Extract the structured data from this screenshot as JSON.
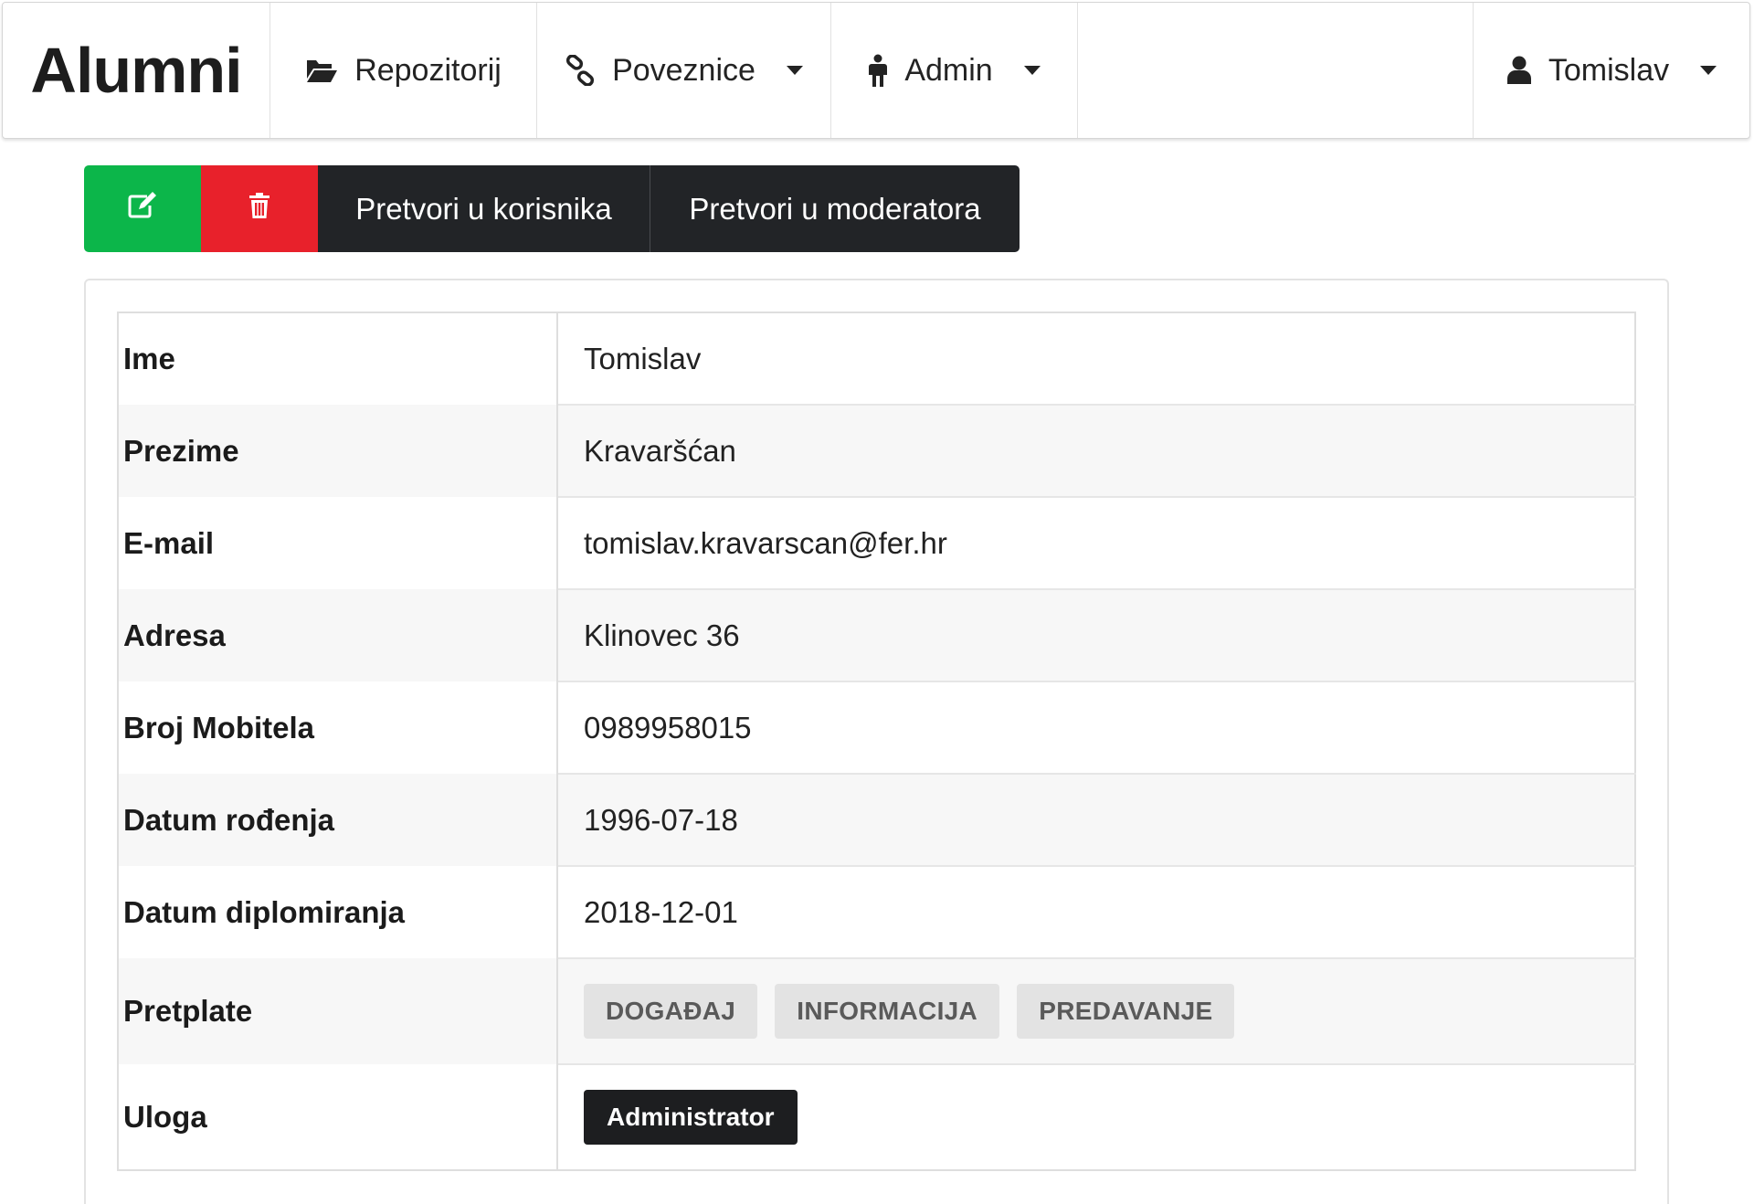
{
  "navbar": {
    "brand": "Alumni",
    "items": [
      {
        "label": "Repozitorij",
        "icon": "folder-open-icon"
      },
      {
        "label": "Poveznice",
        "icon": "link-icon",
        "dropdown": true
      },
      {
        "label": "Admin",
        "icon": "male-icon",
        "dropdown": true
      }
    ],
    "user": {
      "label": "Tomislav",
      "icon": "user-icon",
      "dropdown": true
    }
  },
  "actions": {
    "edit_icon": "edit-icon",
    "delete_icon": "trash-icon",
    "make_user": "Pretvori u korisnika",
    "make_moderator": "Pretvori u moderatora",
    "colors": {
      "edit": "#0cb64a",
      "delete": "#e8212b",
      "dark": "#222427"
    }
  },
  "details": {
    "rows": [
      {
        "label": "Ime",
        "value": "Tomislav"
      },
      {
        "label": "Prezime",
        "value": "Kravaršćan"
      },
      {
        "label": "E-mail",
        "value": "tomislav.kravarscan@fer.hr"
      },
      {
        "label": "Adresa",
        "value": "Klinovec 36"
      },
      {
        "label": "Broj Mobitela",
        "value": "0989958015"
      },
      {
        "label": "Datum rođenja",
        "value": "1996-07-18"
      },
      {
        "label": "Datum diplomiranja",
        "value": "2018-12-01"
      }
    ],
    "subscriptions_label": "Pretplate",
    "subscriptions": [
      "DOGAĐAJ",
      "INFORMACIJA",
      "PREDAVANJE"
    ],
    "role_label": "Uloga",
    "role": "Administrator"
  }
}
